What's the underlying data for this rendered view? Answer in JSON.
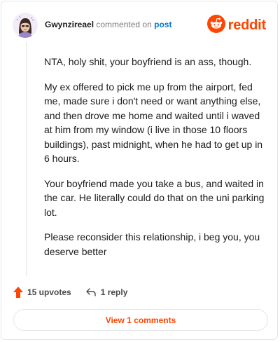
{
  "comment": {
    "username": "Gwynzireael",
    "action": "commented on",
    "post_link": "post",
    "brand": "reddit",
    "paragraphs": [
      "NTA, holy shit, your boyfriend is an ass, though.",
      "My ex offered to pick me up from the airport, fed me, made sure i don't need or want anything else, and then drove me home and waited until i waved at him from my window (i live in those 10 floors buildings), past midnight, when he had to get up in 6 hours.",
      "Your boyfriend made you take a bus, and waited in the car. He literally could do that on the uni parking lot.",
      "Please reconsider this relationship, i beg you, you deserve better"
    ],
    "upvotes": "15 upvotes",
    "replies": "1 reply",
    "view_comments": "View 1 comments"
  },
  "colors": {
    "accent": "#ff4500",
    "link": "#0079d3",
    "muted": "#7c7c7c"
  },
  "icons": [
    "avatar",
    "reddit-logo-icon",
    "upvote-arrow-icon",
    "reply-arrow-icon"
  ]
}
